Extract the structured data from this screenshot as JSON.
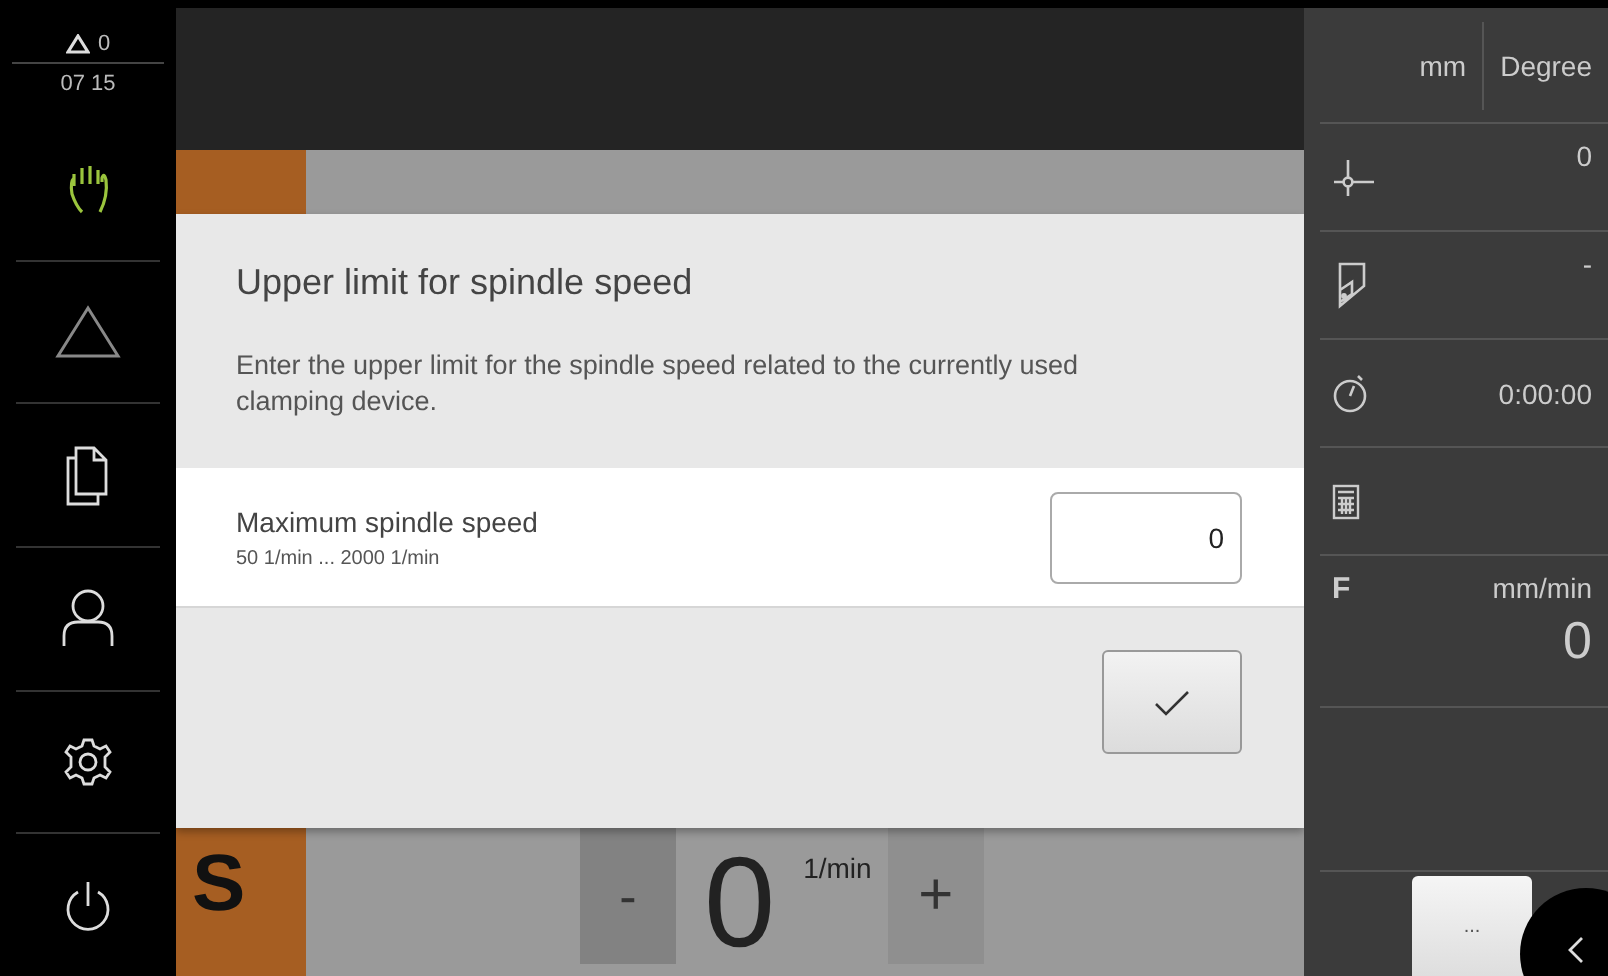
{
  "status": {
    "warnings": "0",
    "time": "07 15"
  },
  "sidebar": {
    "items": [
      {
        "kind": "hand",
        "selected": true
      },
      {
        "kind": "triangle",
        "selected": false
      },
      {
        "kind": "documents",
        "selected": false
      },
      {
        "kind": "user",
        "selected": false
      },
      {
        "kind": "gear",
        "selected": false
      },
      {
        "kind": "power",
        "selected": false
      }
    ]
  },
  "spindle_bar": {
    "axis": "S",
    "minus": "-",
    "value": "0",
    "unit": "1/min",
    "plus": "+"
  },
  "dialog": {
    "title": "Upper limit for spindle speed",
    "description": "Enter the upper limit for the spindle speed related to the currently used clamping device.",
    "field": {
      "label": "Maximum spindle speed",
      "range": "50 1/min ... 2000 1/min",
      "value": "0"
    }
  },
  "right_panel": {
    "units": [
      "mm",
      "Degree"
    ],
    "rows": [
      {
        "kind": "origin",
        "value": "0"
      },
      {
        "kind": "tool",
        "value": "-"
      },
      {
        "kind": "timer",
        "value": "0:00:00"
      },
      {
        "kind": "calculator"
      }
    ],
    "feed": {
      "label": "F",
      "unit": "mm/min",
      "value": "0"
    },
    "more_button": "..."
  }
}
